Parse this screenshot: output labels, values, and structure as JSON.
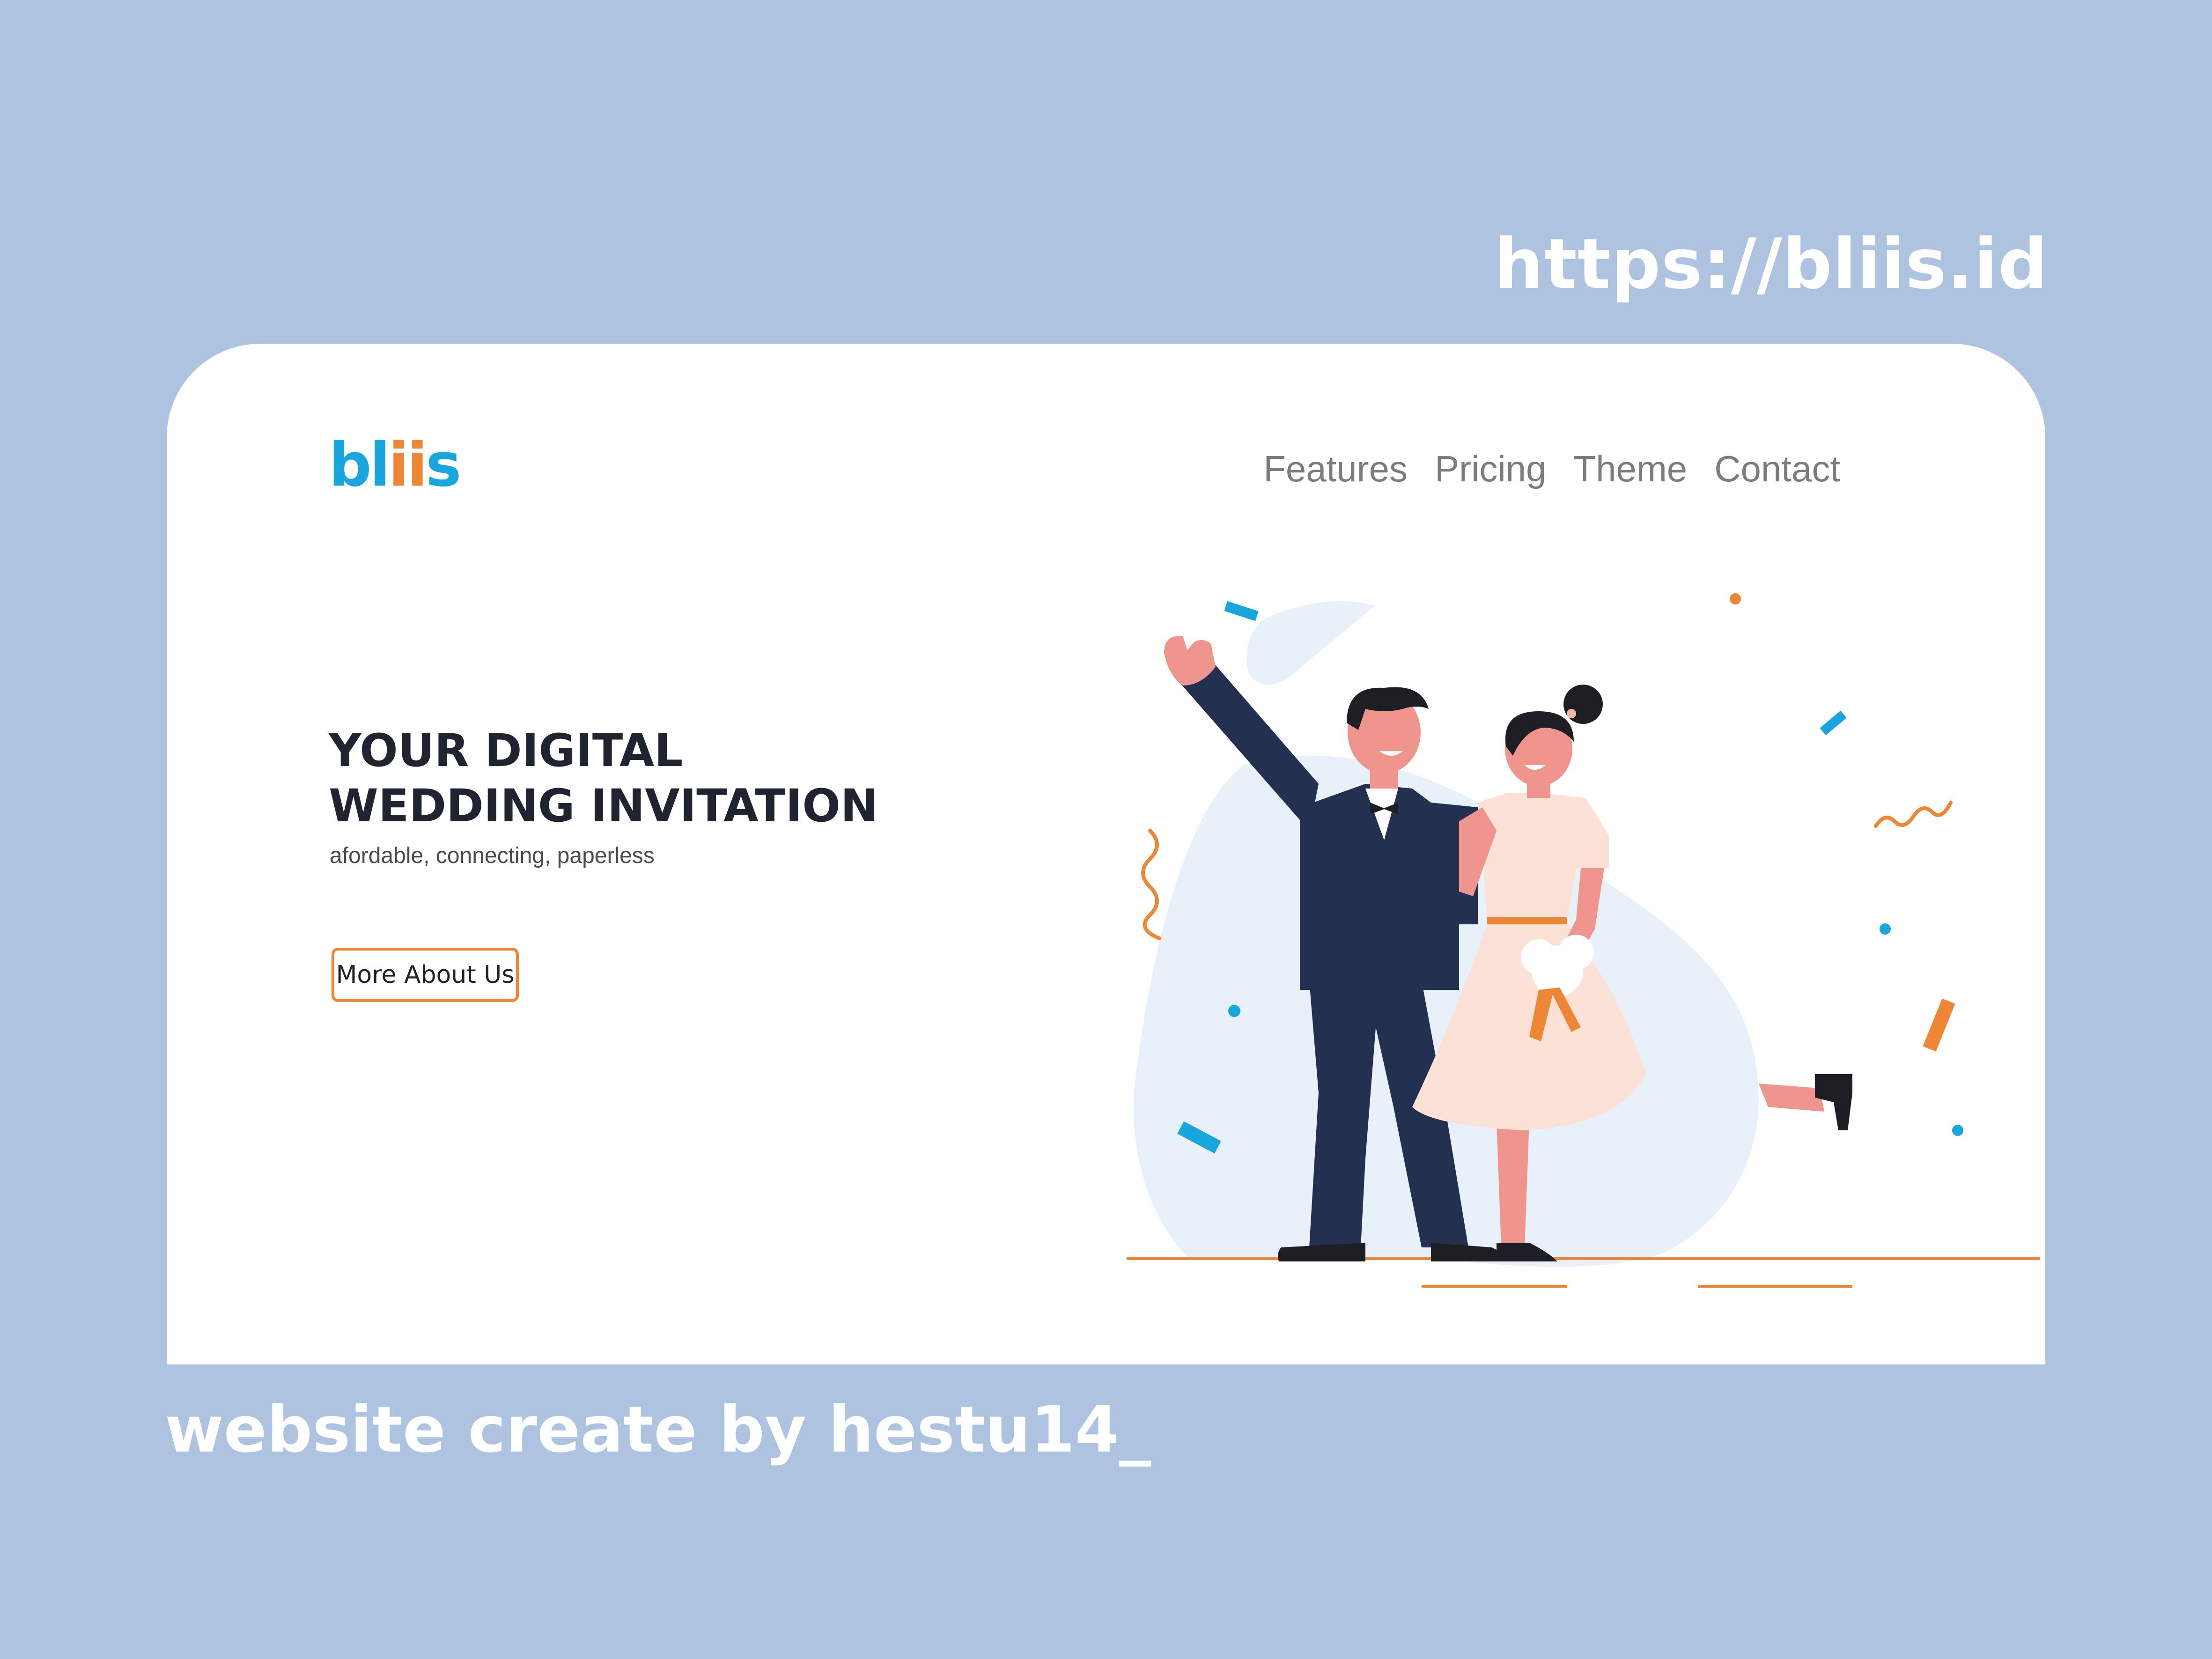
{
  "page": {
    "url_text": "https://bliis.id",
    "credit_text": "website create by hestu14_"
  },
  "header": {
    "logo_prefix": "bl",
    "logo_accent": "ii",
    "logo_suffix": "s",
    "nav": [
      {
        "label": "Features"
      },
      {
        "label": "Pricing"
      },
      {
        "label": "Theme"
      },
      {
        "label": "Contact"
      }
    ]
  },
  "hero": {
    "title_line1": "YOUR DIGITAL",
    "title_line2": "WEDDING INVITATION",
    "subtitle": "afordable, connecting, paperless",
    "button_label": "More About Us"
  },
  "illustration": {
    "icon": "wedding-couple-illustration",
    "colors": {
      "blob": "#e8f0fa",
      "suit": "#24304f",
      "dress": "#fbe1d6",
      "skin": "#f0958d",
      "hair": "#1e1e24",
      "accent_orange": "#ef8636",
      "accent_blue": "#19a6de"
    }
  },
  "theme": {
    "background": "#aec3df",
    "card": "#ffffff",
    "brand_blue": "#19a6de",
    "brand_orange": "#ef8636",
    "heading": "#1f2430"
  }
}
